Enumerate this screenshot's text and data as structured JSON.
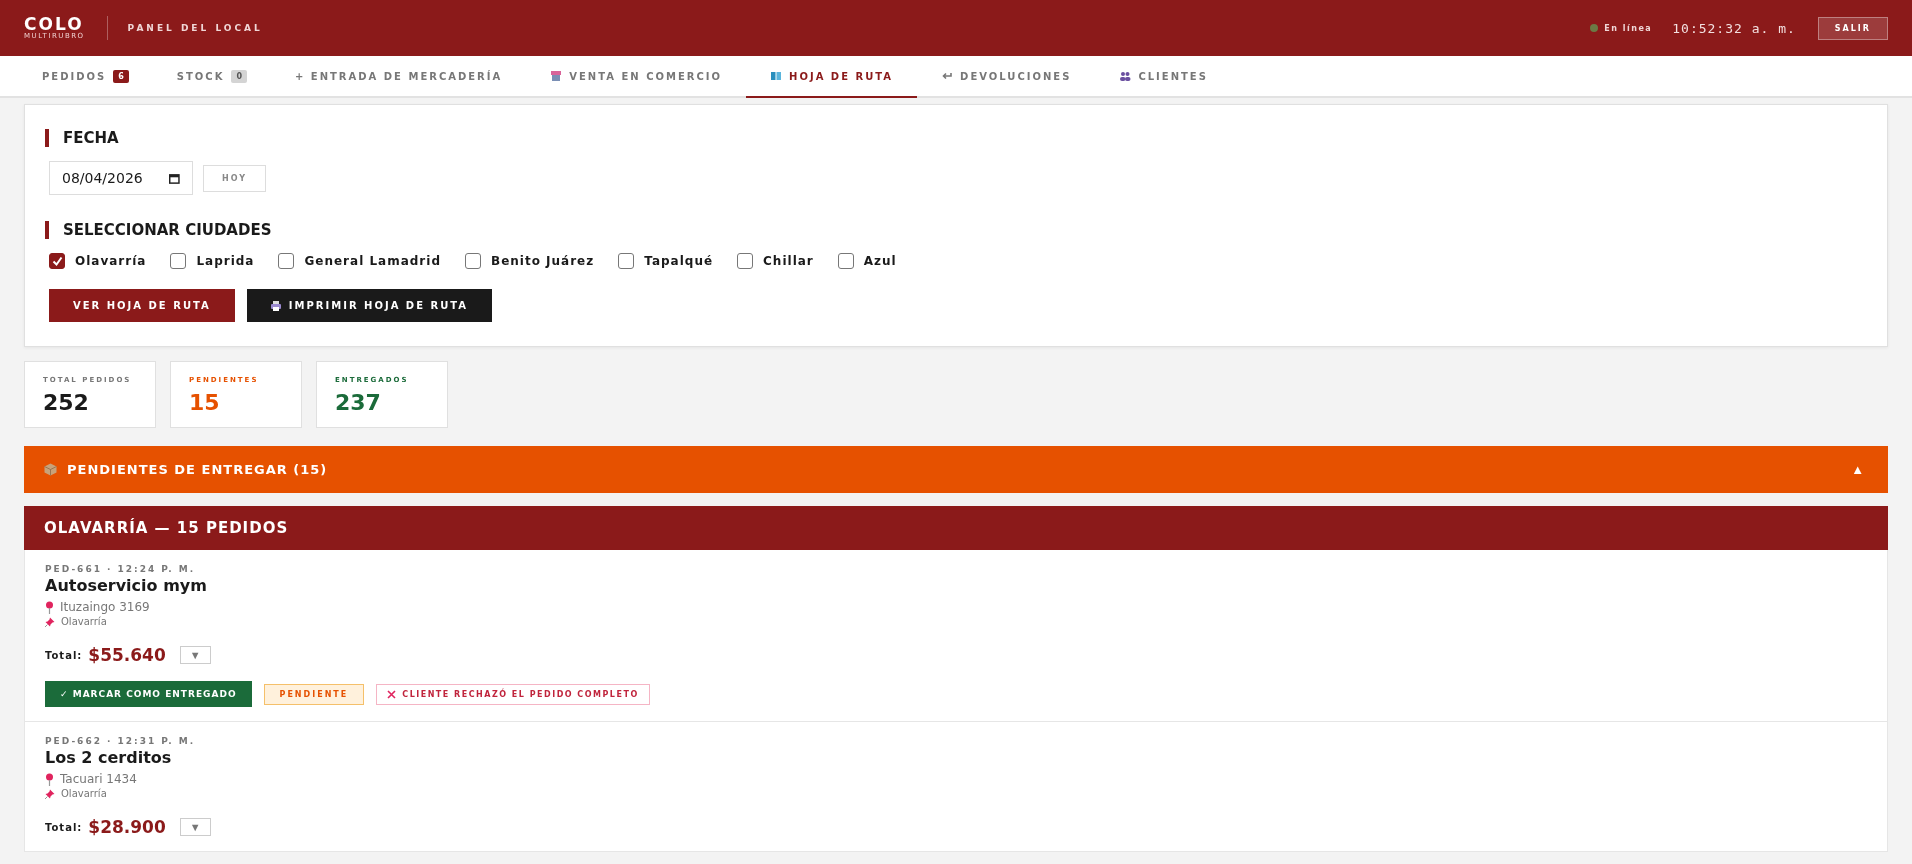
{
  "header": {
    "logo": "COLO",
    "logo_sub": "MULTIRUBRO",
    "title": "PANEL DEL LOCAL",
    "status": {
      "online": true,
      "label": "En línea"
    },
    "clock": "10:52:32 a. m.",
    "logout": "SALIR"
  },
  "tabs": [
    {
      "label": "PEDIDOS",
      "badge": "6",
      "badge_highlighted": true,
      "selected": false
    },
    {
      "label": "STOCK",
      "badge": "0",
      "badge_highlighted": false,
      "selected": false
    },
    {
      "label": "+ ENTRADA DE MERCADERÍA",
      "selected": false
    },
    {
      "label": "VENTA EN COMERCIO",
      "selected": false
    },
    {
      "label": "HOJA DE RUTA",
      "selected": true
    },
    {
      "label": "DEVOLUCIONES",
      "selected": false
    },
    {
      "label": "CLIENTES",
      "selected": false
    }
  ],
  "filters": {
    "date_title": "FECHA",
    "date_value": "08/04/2026",
    "today_button": "HOY",
    "cities_title": "SELECCIONAR CIUDADES",
    "cities": [
      {
        "label": "Olavarría",
        "checked": true
      },
      {
        "label": "Laprida",
        "checked": false
      },
      {
        "label": "General Lamadrid",
        "checked": false
      },
      {
        "label": "Benito Juárez",
        "checked": false
      },
      {
        "label": "Tapalqué",
        "checked": false
      },
      {
        "label": "Chillar",
        "checked": false
      },
      {
        "label": "Azul",
        "checked": false
      }
    ],
    "view_button": "VER HOJA DE RUTA",
    "print_button": "IMPRIMIR HOJA DE RUTA"
  },
  "stats": [
    {
      "label": "TOTAL PEDIDOS",
      "value": "252",
      "color": "#1a1a1a"
    },
    {
      "label": "PENDIENTES",
      "value": "15",
      "color": "#e65100"
    },
    {
      "label": "ENTREGADOS",
      "value": "237",
      "color": "#1b6b3a"
    }
  ],
  "pending_section": {
    "title": "PENDIENTES DE ENTREGAR (15)",
    "toggle": "▲",
    "expanded": true
  },
  "city_group": {
    "title": "OLAVARRÍA — 15 PEDIDOS"
  },
  "orders": [
    {
      "meta": "PED-661 · 12:24 P. M.",
      "name": "Autoservicio mym",
      "address": "Ituzaingo 3169",
      "city": "Olavarría",
      "total_label": "Total:",
      "total": "$55.640",
      "toggle": "▼",
      "deliver_button": "✓ MARCAR COMO ENTREGADO",
      "status": "PENDIENTE",
      "reject_button": "CLIENTE RECHAZÓ EL PEDIDO COMPLETO"
    },
    {
      "meta": "PED-662 · 12:31 P. M.",
      "name": "Los 2 cerditos",
      "address": "Tacuari 1434",
      "city": "Olavarría",
      "total_label": "Total:",
      "total": "$28.900",
      "toggle": "▼"
    }
  ]
}
